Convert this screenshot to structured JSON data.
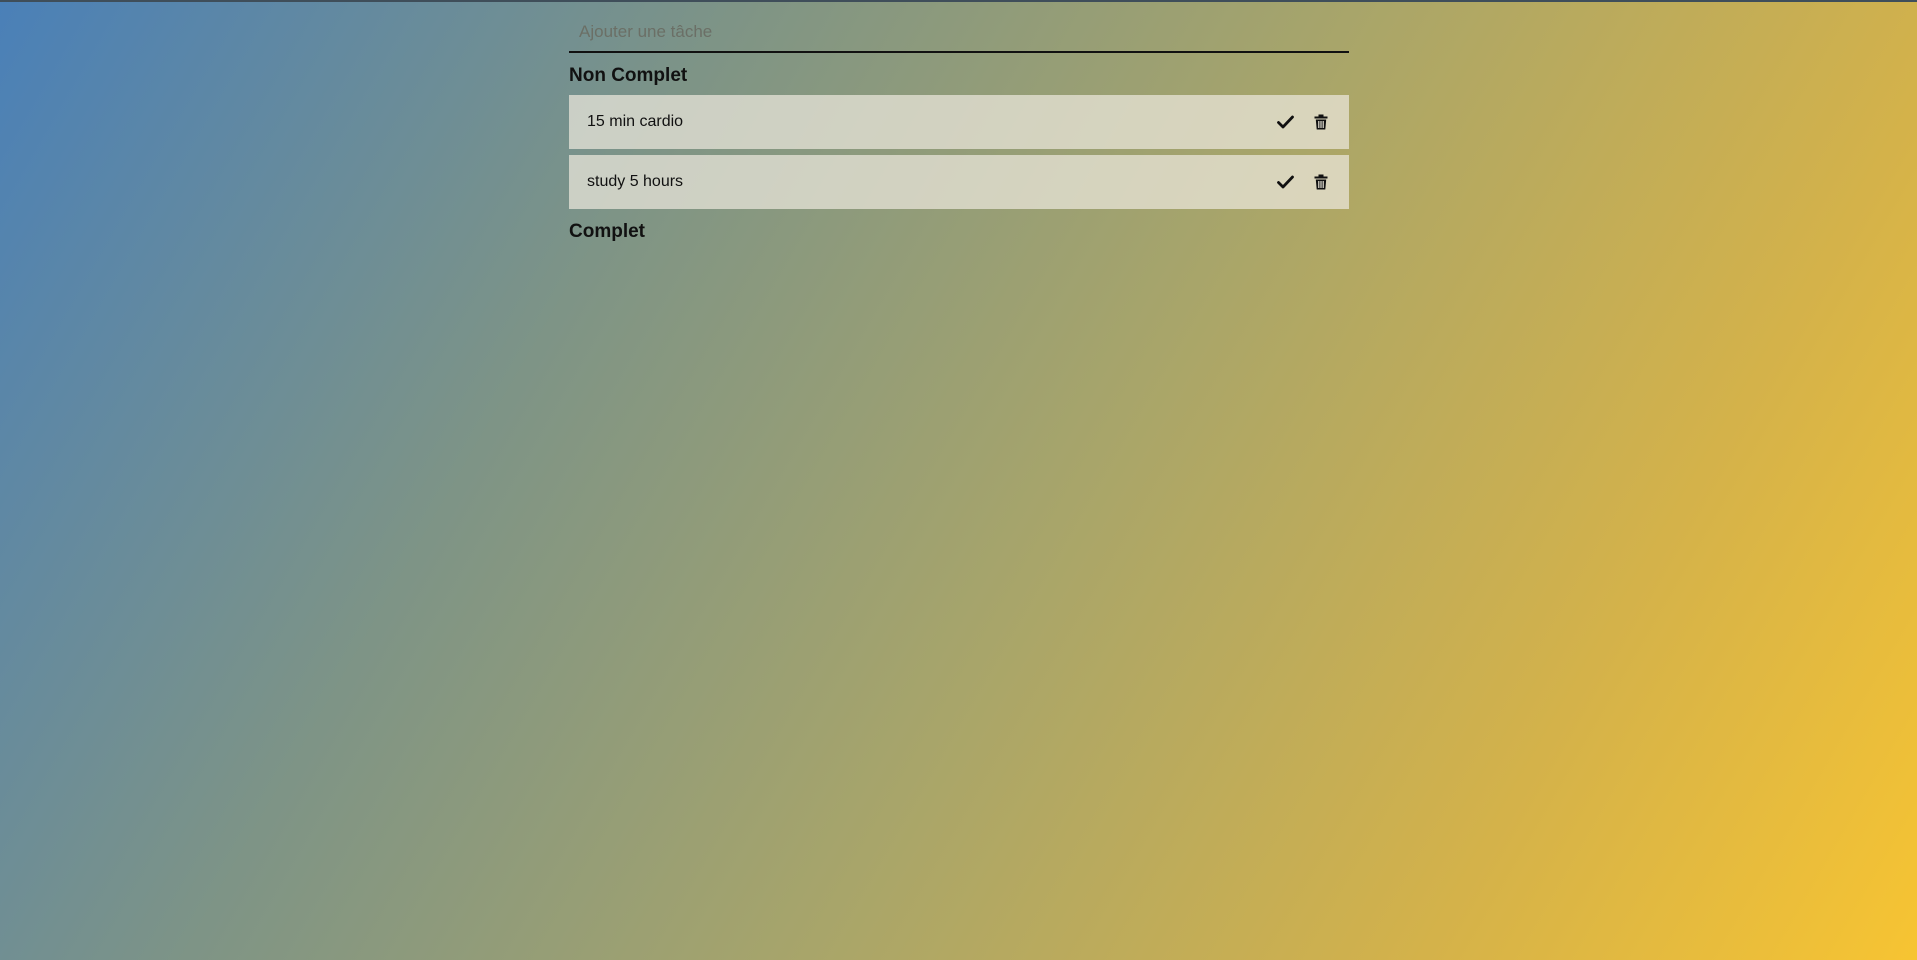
{
  "input": {
    "placeholder": "Ajouter une tâche",
    "value": ""
  },
  "sections": {
    "incomplete": {
      "title": "Non Complet",
      "items": [
        {
          "text": "15 min cardio",
          "complete_icon": "check-icon",
          "delete_icon": "trash-icon"
        },
        {
          "text": "study 5 hours",
          "complete_icon": "check-icon",
          "delete_icon": "trash-icon"
        }
      ]
    },
    "complete": {
      "title": "Complet",
      "items": []
    }
  },
  "colors": {
    "gradient_start": "#4a80b8",
    "gradient_end": "#f7c432",
    "item_background": "#ebe8dc",
    "text": "#111111"
  }
}
